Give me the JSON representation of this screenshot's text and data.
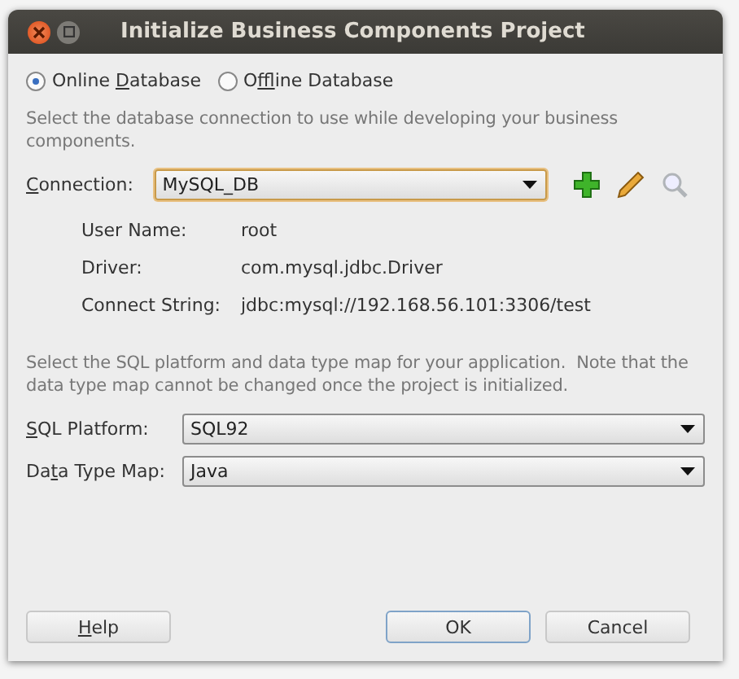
{
  "window": {
    "title": "Initialize Business Components Project"
  },
  "source_options": [
    {
      "pre": "Online ",
      "key": "D",
      "post": "atabase",
      "selected": true
    },
    {
      "pre": "O",
      "key": "f",
      "post": "fline Database",
      "selected": false
    }
  ],
  "connection_hint": "Select the database connection to use while developing your business components.",
  "connection": {
    "key": "C",
    "post": "onnection:",
    "value": "MySQL_DB"
  },
  "details": [
    {
      "label": "User Name:",
      "value": "root"
    },
    {
      "label": "Driver:",
      "value": "com.mysql.jdbc.Driver"
    },
    {
      "label": "Connect String:",
      "value": "jdbc:mysql://192.168.56.101:3306/test"
    }
  ],
  "platform_hint": "Select the SQL platform and data type map for your application.  Note that the data type map cannot be changed once the project is initialized.",
  "selects": [
    {
      "key": "S",
      "post": "QL Platform:",
      "value": "SQL92"
    },
    {
      "pre": "Da",
      "key": "t",
      "post": "a Type Map:",
      "value": "Java"
    }
  ],
  "buttons": [
    {
      "key": "H",
      "post": "elp",
      "kind": "help",
      "default": false
    },
    {
      "pre": "OK",
      "kind": "action",
      "default": true
    },
    {
      "pre": "Cancel",
      "kind": "action",
      "default": false
    }
  ]
}
